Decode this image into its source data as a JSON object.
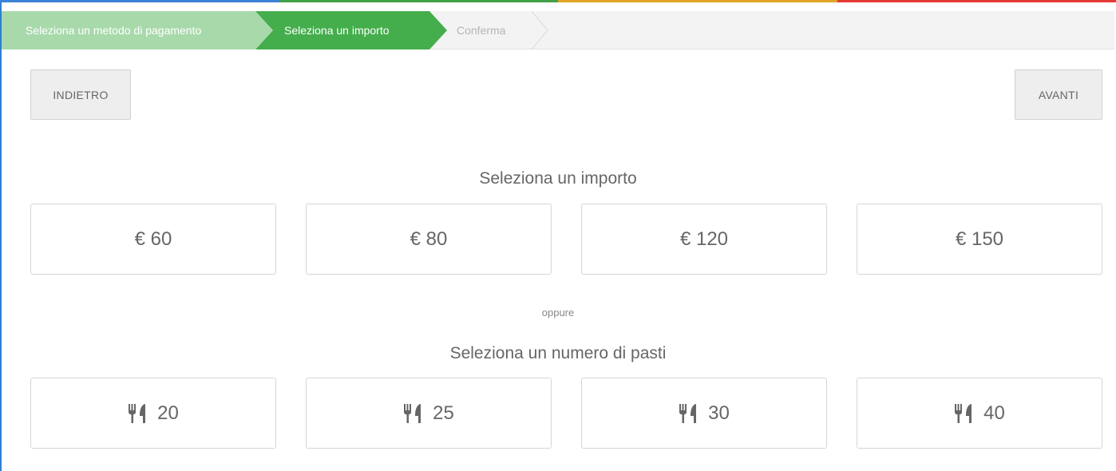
{
  "steps": [
    {
      "label": "Seleziona un metodo di pagamento",
      "state": "done"
    },
    {
      "label": "Seleziona un importo",
      "state": "active"
    },
    {
      "label": "Conferma",
      "state": "pending"
    }
  ],
  "nav": {
    "back_label": "INDIETRO",
    "next_label": "AVANTI"
  },
  "amounts": {
    "heading": "Seleziona un importo",
    "options": [
      "€ 60",
      "€ 80",
      "€ 120",
      "€ 150"
    ]
  },
  "separator": "oppure",
  "meals": {
    "heading": "Seleziona un numero di pasti",
    "icon": "fork-knife-icon",
    "options": [
      "20",
      "25",
      "30",
      "40"
    ]
  },
  "colors": {
    "step_done": "#a8d9ab",
    "step_active": "#44ae4c",
    "frame_accent": "#2f7fd1"
  }
}
